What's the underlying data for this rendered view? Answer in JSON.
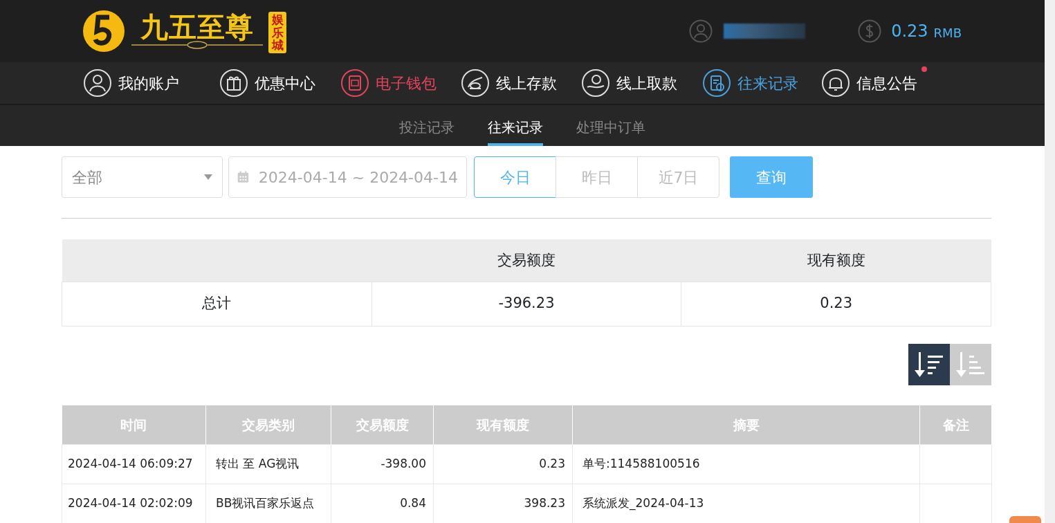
{
  "logo": {
    "title": "九五至尊",
    "badge": "娱乐城"
  },
  "account": {
    "balance": "0.23",
    "currency": "RMB"
  },
  "nav": [
    {
      "label": "我的账户",
      "kind": "user",
      "color": "#ffffff",
      "dot": false
    },
    {
      "label": "优惠中心",
      "kind": "gift",
      "color": "#ffffff",
      "dot": false
    },
    {
      "label": "电子钱包",
      "kind": "wallet",
      "color": "#e8435e",
      "dot": false
    },
    {
      "label": "线上存款",
      "kind": "deposit",
      "color": "#ffffff",
      "dot": false
    },
    {
      "label": "线上取款",
      "kind": "withdraw",
      "color": "#ffffff",
      "dot": false
    },
    {
      "label": "往来记录",
      "kind": "records",
      "color": "#4aa3df",
      "dot": false
    },
    {
      "label": "信息公告",
      "kind": "bell",
      "color": "#ffffff",
      "dot": true
    }
  ],
  "subtabs": [
    {
      "label": "投注记录",
      "selected": false
    },
    {
      "label": "往来记录",
      "selected": true
    },
    {
      "label": "处理中订单",
      "selected": false
    }
  ],
  "filters": {
    "type_select": "全部",
    "date_range": "2024-04-14 ~ 2024-04-14",
    "periods": [
      {
        "label": "今日",
        "selected": true
      },
      {
        "label": "昨日",
        "selected": false
      },
      {
        "label": "近7日",
        "selected": false
      }
    ],
    "query_button": "查询"
  },
  "summary": {
    "columns": [
      "交易额度",
      "现有额度"
    ],
    "rows": [
      {
        "label": "总计",
        "amount": "-396.23",
        "balance": "0.23"
      }
    ]
  },
  "sort_buttons": [
    {
      "kind": "desc",
      "selected": true
    },
    {
      "kind": "asc",
      "selected": false
    }
  ],
  "records": {
    "columns": [
      "时间",
      "交易类别",
      "交易额度",
      "现有额度",
      "摘要",
      "备注"
    ],
    "rows": [
      {
        "time": "2024-04-14 06:09:27",
        "type": "转出 至 AG视讯",
        "amount": "-398.00",
        "balance": "0.23",
        "summary": "单号:114588100516"
      },
      {
        "time": "2024-04-14 02:02:09",
        "type": "BB视讯百家乐返点",
        "amount": "0.84",
        "balance": "398.23",
        "summary": "系统派发_2024-04-13"
      }
    ]
  }
}
